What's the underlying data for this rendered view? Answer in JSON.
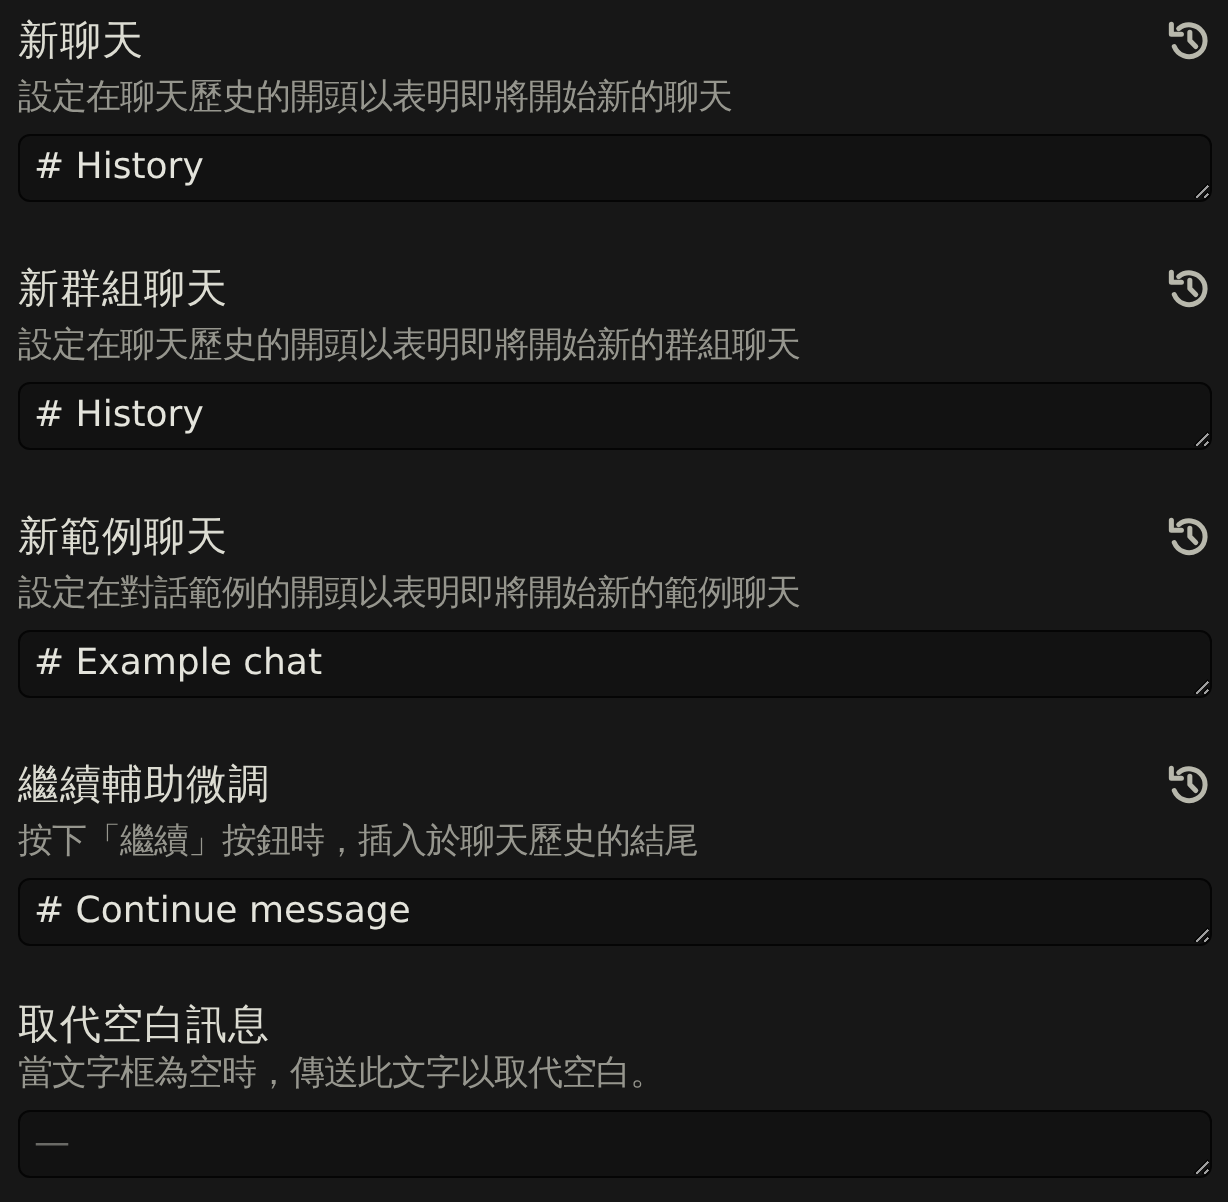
{
  "settings": [
    {
      "title": "新聊天",
      "description": "設定在聊天歷史的開頭以表明即將開始新的聊天",
      "value": "# History",
      "resettable": true
    },
    {
      "title": "新群組聊天",
      "description": "設定在聊天歷史的開頭以表明即將開始新的群組聊天",
      "value": "# History",
      "resettable": true
    },
    {
      "title": "新範例聊天",
      "description": "設定在對話範例的開頭以表明即將開始新的範例聊天",
      "value": "# Example chat",
      "resettable": true
    },
    {
      "title": "繼續輔助微調",
      "description": "按下「繼續」按鈕時，插入於聊天歷史的結尾",
      "value": "# Continue message",
      "resettable": true
    },
    {
      "title": "取代空白訊息",
      "description": "當文字框為空時，傳送此文字以取代空白。",
      "placeholder": "—",
      "resettable": false
    }
  ]
}
